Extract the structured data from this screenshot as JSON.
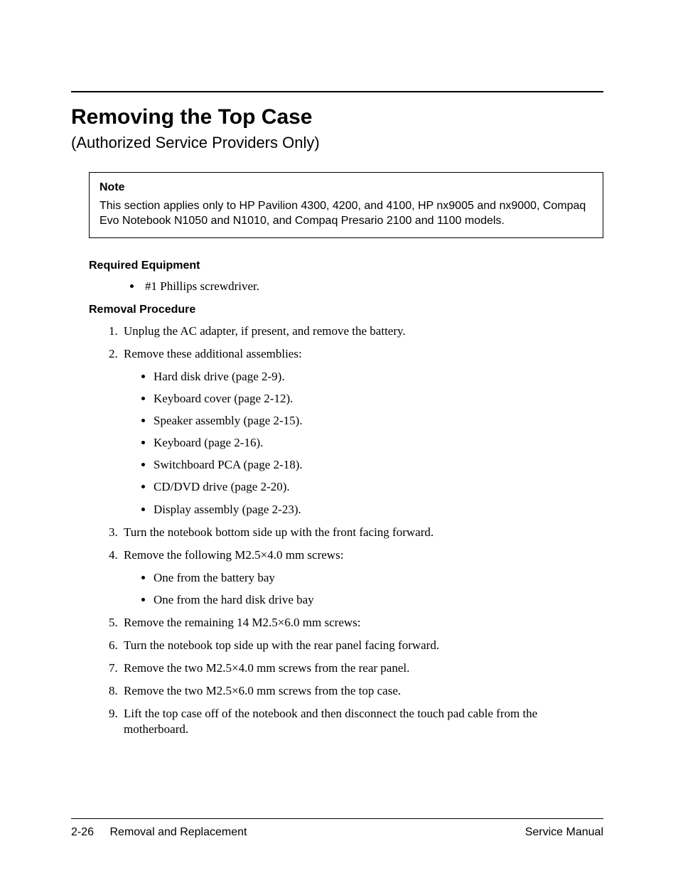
{
  "header": {
    "title": "Removing the Top Case",
    "subtitle": "(Authorized Service Providers Only)"
  },
  "note": {
    "label": "Note",
    "body": "This section applies only to HP Pavilion 4300, 4200, and 4100, HP nx9005 and nx9000, Compaq Evo Notebook N1050 and N1010, and Compaq Presario 2100 and 1100 models."
  },
  "equipment": {
    "heading": "Required Equipment",
    "items": [
      "#1 Phillips screwdriver."
    ]
  },
  "procedure": {
    "heading": "Removal Procedure",
    "steps": {
      "s1": "Unplug the AC adapter, if present, and remove the battery.",
      "s2": "Remove these additional assemblies:",
      "s2_sub": [
        "Hard disk drive (page 2-9).",
        "Keyboard cover (page 2-12).",
        "Speaker assembly (page 2-15).",
        "Keyboard (page 2-16).",
        "Switchboard PCA (page 2-18).",
        "CD/DVD drive (page 2-20).",
        "Display assembly (page 2-23)."
      ],
      "s3": "Turn the notebook bottom side up with the front facing forward.",
      "s4": "Remove the following M2.5×4.0 mm screws:",
      "s4_sub": [
        "One from the battery bay",
        "One from the hard disk drive bay"
      ],
      "s5": "Remove the remaining 14 M2.5×6.0 mm screws:",
      "s6": "Turn the notebook top side up with the rear panel facing forward.",
      "s7": "Remove the two M2.5×4.0 mm screws from the rear panel.",
      "s8": "Remove the two M2.5×6.0 mm screws from the top case.",
      "s9": "Lift the top case off of the notebook and then disconnect the touch pad cable from the motherboard."
    }
  },
  "footer": {
    "page_number": "2-26",
    "section": "Removal and Replacement",
    "doc": "Service Manual"
  }
}
